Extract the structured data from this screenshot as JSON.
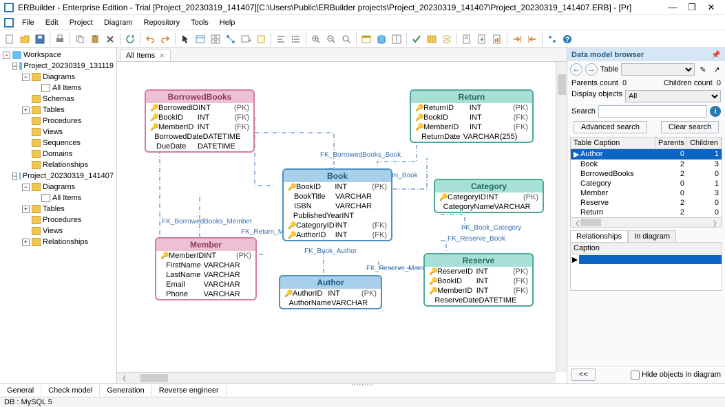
{
  "title": "ERBuilder - Enterprise Edition - Trial [Project_20230319_141407][C:\\Users\\Public\\ERBuilder projects\\Project_20230319_141407\\Project_20230319_141407.ERB] - [Pr]",
  "menus": [
    "File",
    "Edit",
    "Project",
    "Diagram",
    "Repository",
    "Tools",
    "Help"
  ],
  "tree": {
    "root": "Workspace",
    "projects": [
      {
        "name": "Project_20230319_131119",
        "nodes": [
          {
            "label": "Diagrams",
            "children": [
              "All Items"
            ]
          },
          {
            "label": "Schemas"
          },
          {
            "label": "Tables"
          },
          {
            "label": "Procedures"
          },
          {
            "label": "Views"
          },
          {
            "label": "Sequences"
          },
          {
            "label": "Domains"
          },
          {
            "label": "Relationships"
          }
        ]
      },
      {
        "name": "Project_20230319_141407",
        "nodes": [
          {
            "label": "Diagrams",
            "children": [
              "All Items"
            ]
          },
          {
            "label": "Tables"
          },
          {
            "label": "Procedures"
          },
          {
            "label": "Views"
          },
          {
            "label": "Relationships"
          }
        ]
      }
    ]
  },
  "canvas_tab": "All Items",
  "entities": {
    "BorrowedBooks": {
      "color": "pink",
      "rows": [
        [
          "🔑",
          "BorrowedID",
          "INT",
          "(PK)"
        ],
        [
          "🔑",
          "BookID",
          "INT",
          "(FK)"
        ],
        [
          "🔑",
          "MemberID",
          "INT",
          "(FK)"
        ],
        [
          "",
          "BorrowedDate",
          "DATETIME",
          ""
        ],
        [
          "",
          "DueDate",
          "DATETIME",
          ""
        ]
      ]
    },
    "Return": {
      "color": "teal",
      "rows": [
        [
          "🔑",
          "ReturnID",
          "INT",
          "(PK)"
        ],
        [
          "🔑",
          "BookID",
          "INT",
          "(FK)"
        ],
        [
          "🔑",
          "MemberID",
          "INT",
          "(FK)"
        ],
        [
          "",
          "ReturnDate",
          "VARCHAR(255)",
          ""
        ]
      ]
    },
    "Book": {
      "color": "blue",
      "rows": [
        [
          "🔑",
          "BookID",
          "INT",
          "(PK)"
        ],
        [
          "",
          "BookTitle",
          "VARCHAR",
          ""
        ],
        [
          "",
          "ISBN",
          "VARCHAR",
          ""
        ],
        [
          "",
          "PublishedYear",
          "INT",
          ""
        ],
        [
          "🔑",
          "CategoryID",
          "INT",
          "(FK)"
        ],
        [
          "🔑",
          "AuthorID",
          "INT",
          "(FK)"
        ]
      ]
    },
    "Category": {
      "color": "teal",
      "rows": [
        [
          "🔑",
          "CategoryID",
          "INT",
          "(PK)"
        ],
        [
          "",
          "CategoryName",
          "VARCHAR",
          ""
        ]
      ]
    },
    "Member": {
      "color": "pink",
      "rows": [
        [
          "🔑",
          "MemberID",
          "INT",
          "(PK)"
        ],
        [
          "",
          "FirstName",
          "VARCHAR",
          ""
        ],
        [
          "",
          "LastName",
          "VARCHAR",
          ""
        ],
        [
          "",
          "Email",
          "VARCHAR",
          ""
        ],
        [
          "",
          "Phone",
          "VARCHAR",
          ""
        ]
      ]
    },
    "Author": {
      "color": "blue",
      "rows": [
        [
          "🔑",
          "AuthorID",
          "INT",
          "(PK)"
        ],
        [
          "",
          "AuthorName",
          "VARCHAR",
          ""
        ]
      ]
    },
    "Reserve": {
      "color": "teal",
      "rows": [
        [
          "🔑",
          "ReserveID",
          "INT",
          "(PK)"
        ],
        [
          "🔑",
          "BookID",
          "INT",
          "(FK)"
        ],
        [
          "🔑",
          "MemberID",
          "INT",
          "(FK)"
        ],
        [
          "",
          "ReserveDate",
          "DATETIME",
          ""
        ]
      ]
    }
  },
  "fk_labels": {
    "bb_book": "FK_BorrowedBooks_Book",
    "ret_book": "FK_Return_Book",
    "bb_member": "FK_BorrowedBooks_Member",
    "ret_member": "FK_Return_Member",
    "book_author": "FK_Book_Author",
    "book_cat": "FK_Book_Category",
    "res_book": "FK_Reserve_Book",
    "res_member": "FK_Reserve_Member"
  },
  "right": {
    "title": "Data model browser",
    "table_label": "Table",
    "parents_label": "Parents count",
    "parents_count": "0",
    "children_label": "Children count",
    "children_count": "0",
    "display_label": "Display objects",
    "display_value": "All",
    "search_label": "Search",
    "adv_search": "Advanced search",
    "clear_search": "Clear search",
    "grid_headers": [
      "Table Caption",
      "Parents",
      "Children"
    ],
    "grid_rows": [
      {
        "name": "Author",
        "p": "0",
        "c": "1"
      },
      {
        "name": "Book",
        "p": "2",
        "c": "3"
      },
      {
        "name": "BorrowedBooks",
        "p": "2",
        "c": "0"
      },
      {
        "name": "Category",
        "p": "0",
        "c": "1"
      },
      {
        "name": "Member",
        "p": "0",
        "c": "3"
      },
      {
        "name": "Reserve",
        "p": "2",
        "c": "0"
      },
      {
        "name": "Return",
        "p": "2",
        "c": "0"
      }
    ],
    "tabs": [
      "Relationships",
      "In diagram"
    ],
    "caption_header": "Caption",
    "nav_prev": "<<",
    "hide_label": "Hide objects in diagram"
  },
  "bottom_tabs": [
    "General",
    "Check model",
    "Generation",
    "Reverse engineer"
  ],
  "status": "DB : MySQL 5"
}
